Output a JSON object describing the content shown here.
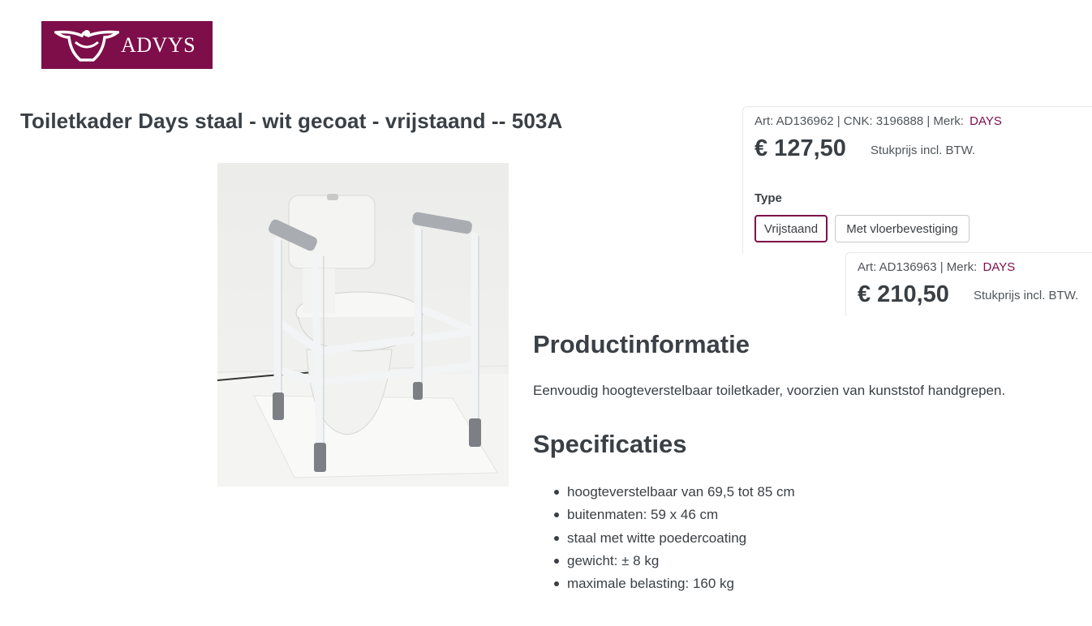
{
  "header": {
    "logo_text": "ADVYS"
  },
  "product": {
    "title": "Toiletkader Days staal - wit gecoat - vrijstaand -- 503A",
    "image_alt": "Toiletkader Days staal wit gecoat vrijstaand"
  },
  "variant_primary": {
    "art_prefix": "Art: AD136962 | CNK: 3196888 | Merk:",
    "brand": "DAYS",
    "price": "€ 127,50",
    "price_note": "Stukprijs incl. BTW.",
    "type_label": "Type",
    "options": [
      {
        "label": "Vrijstaand",
        "selected": true
      },
      {
        "label": "Met vloerbevestiging",
        "selected": false
      }
    ]
  },
  "variant_secondary": {
    "art_prefix": "Art: AD136963 | Merk:",
    "brand": "DAYS",
    "price": "€ 210,50",
    "price_note": "Stukprijs incl. BTW."
  },
  "info": {
    "heading": "Productinformatie",
    "description": "Eenvoudig hoogteverstelbaar toiletkader, voorzien van kunststof handgrepen."
  },
  "specs": {
    "heading": "Specificaties",
    "items": [
      "hoogteverstelbaar van 69,5 tot 85 cm",
      "buitenmaten: 59 x 46 cm",
      "staal met witte poedercoating",
      "gewicht: ± 8 kg",
      "maximale belasting: 160 kg"
    ]
  },
  "colors": {
    "brand_accent": "#7d0e4a",
    "text": "#3a3f44"
  }
}
